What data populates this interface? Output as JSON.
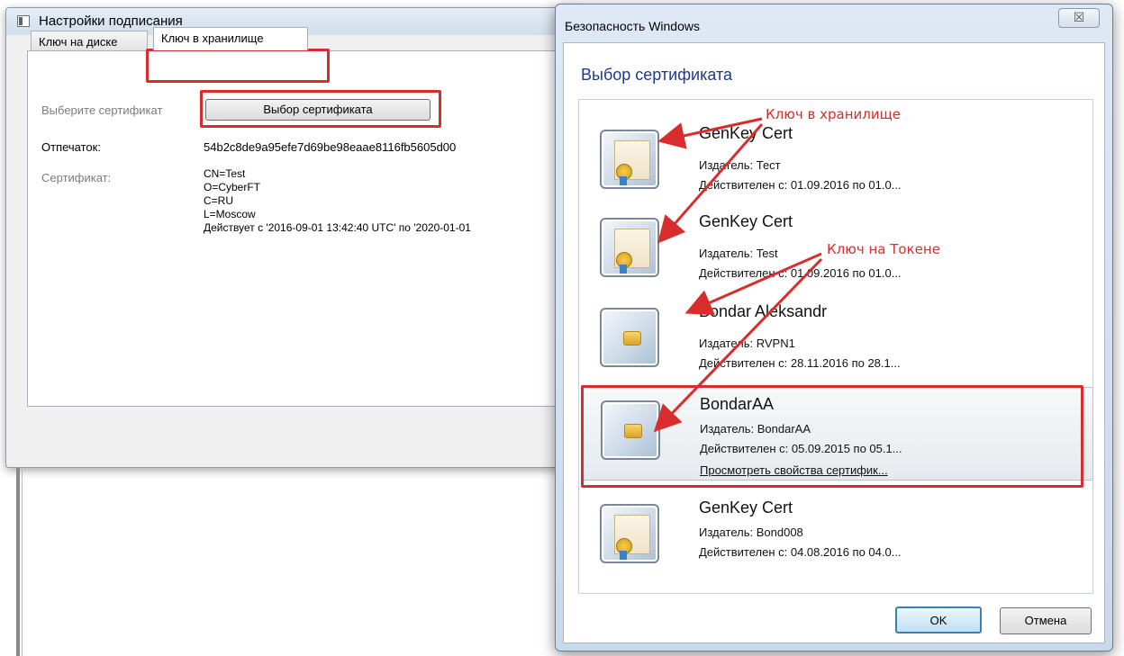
{
  "settings_dialog": {
    "title": "Настройки подписания",
    "tabs": [
      {
        "label": "Ключ на диске"
      },
      {
        "label": "Ключ в хранилище"
      }
    ],
    "select_label": "Выберите сертификат",
    "select_button": "Выбор сертификата",
    "thumbprint_label": "Отпечаток:",
    "thumbprint_value": "54b2c8de9a95efe7d69be98eaae8116fb5605d00",
    "certificate_label": "Сертификат:",
    "certificate_lines": [
      "CN=Test",
      "O=CyberFT",
      "C=RU",
      "L=Moscow",
      "Действует с '2016-09-01 13:42:40 UTC' по '2020-01-01"
    ]
  },
  "security_dialog": {
    "title": "Безопасность Windows",
    "close_glyph": "☒",
    "heading": "Выбор сертификата",
    "certificates": [
      {
        "name": "GenKey Cert",
        "issuer": "Издатель: Тест",
        "validity": "Действителен с: 01.09.2016 по 01.0...",
        "icon": "certificate-icon"
      },
      {
        "name": "GenKey Cert",
        "issuer": "Издатель: Test",
        "validity": "Действителен с: 01.09.2016 по 01.0...",
        "icon": "certificate-icon"
      },
      {
        "name": "Bondar Aleksandr",
        "issuer": "Издатель: RVPN1",
        "validity": "Действителен с: 28.11.2016 по 28.1...",
        "icon": "smartcard-icon"
      },
      {
        "name": "BondarAA",
        "issuer": "Издатель: BondarAA",
        "validity": "Действителен с: 05.09.2015 по 05.1...",
        "link": "Просмотреть свойства сертифик...",
        "icon": "smartcard-icon"
      },
      {
        "name": "GenKey Cert",
        "issuer": "Издатель: Bond008",
        "validity": "Действителен с: 04.08.2016 по 04.0...",
        "icon": "certificate-icon"
      }
    ],
    "ok_button": "OK",
    "cancel_button": "Отмена"
  },
  "annotations": {
    "store_key": "Ключ в хранилище",
    "token_key": "Ключ на Токене",
    "color": "#d92d2d"
  }
}
